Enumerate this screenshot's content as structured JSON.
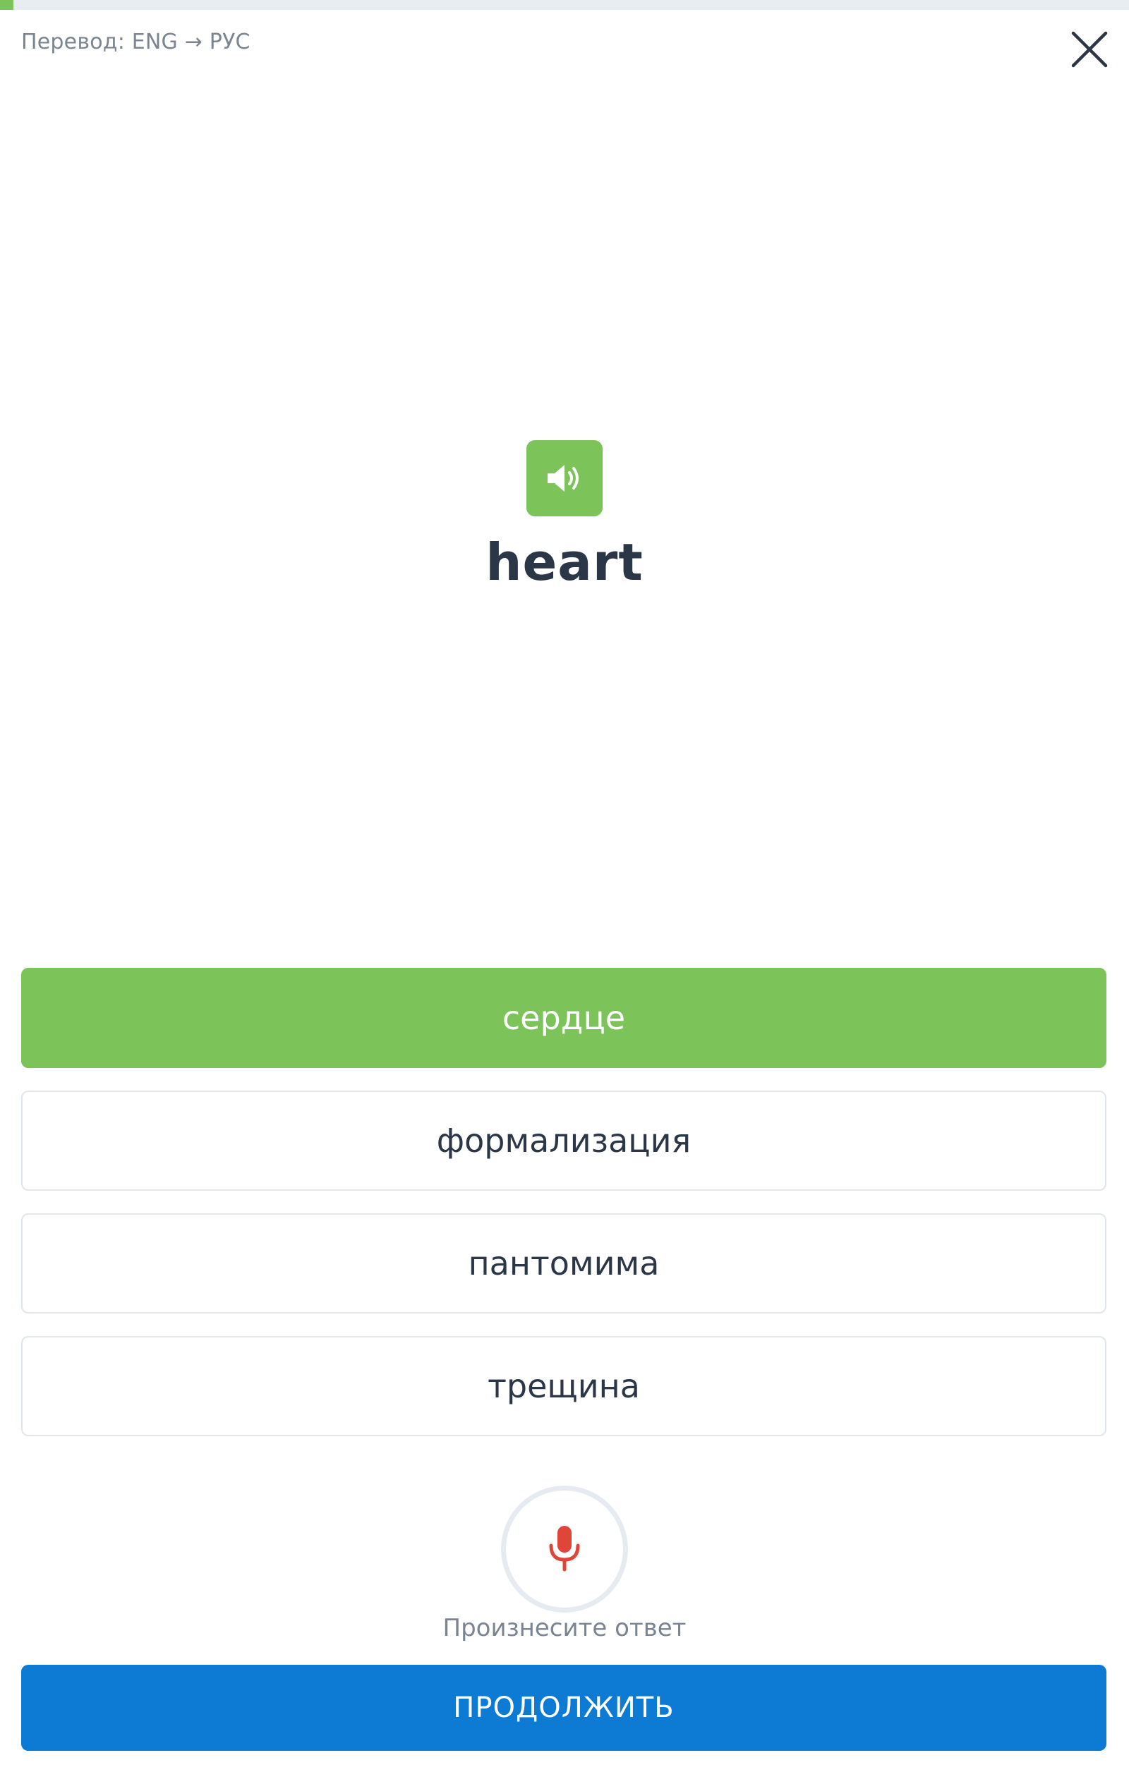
{
  "progress": {
    "fraction": 0.012,
    "track_color": "#e8edf2",
    "fill_color": "#7cc35a"
  },
  "header": {
    "mode_label": "Перевод: ENG → РУС",
    "close_icon": "close-icon"
  },
  "card": {
    "audio_icon": "speaker-icon",
    "word": "heart"
  },
  "options": [
    {
      "label": "сердце",
      "state": "correct"
    },
    {
      "label": "формализация",
      "state": "default"
    },
    {
      "label": "пантомима",
      "state": "default"
    },
    {
      "label": "трещина",
      "state": "default"
    }
  ],
  "voice": {
    "mic_icon": "microphone-icon",
    "caption": "Произнесите ответ"
  },
  "footer": {
    "continue_label": "ПРОДОЛЖИТЬ"
  },
  "colors": {
    "green": "#7cc35a",
    "blue": "#0d7bd4",
    "mic_red": "#e0453a",
    "text_dark": "#2b3646",
    "text_muted": "#7b8591"
  }
}
